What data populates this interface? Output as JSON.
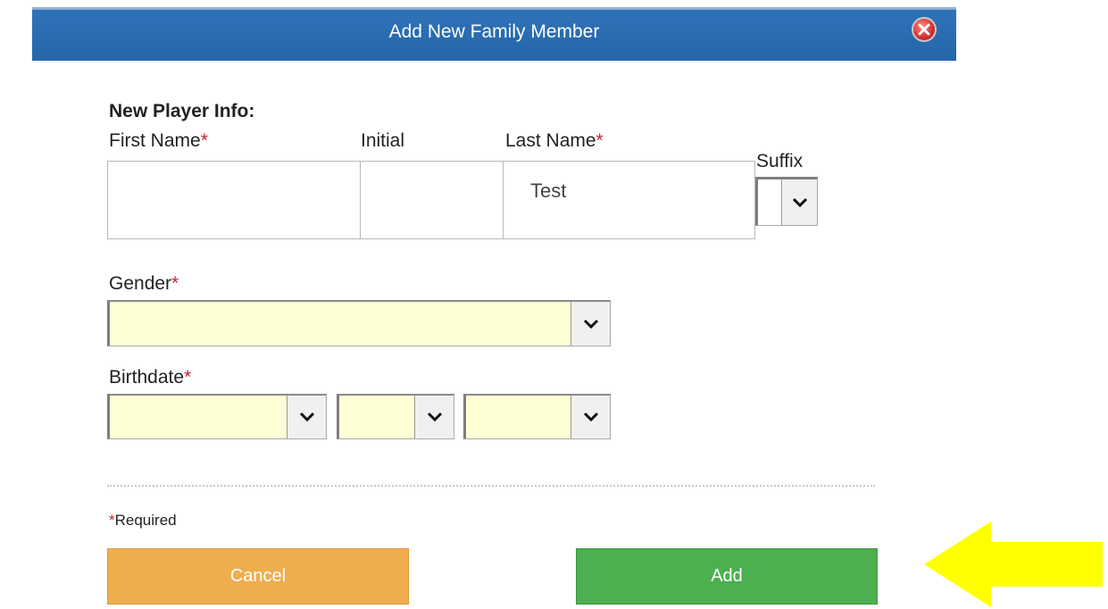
{
  "dialog": {
    "title": "Add New Family Member"
  },
  "form": {
    "section_title": "New Player Info:",
    "first_name": {
      "label": "First Name",
      "value": ""
    },
    "initial": {
      "label": "Initial",
      "value": ""
    },
    "last_name": {
      "label": "Last Name",
      "value": "Test"
    },
    "suffix": {
      "label": "Suffix",
      "value": ""
    },
    "gender": {
      "label": "Gender",
      "value": ""
    },
    "birthdate": {
      "label": "Birthdate",
      "month": "",
      "day": "",
      "year": ""
    },
    "required_marker": "*",
    "required_note": "Required"
  },
  "buttons": {
    "cancel": "Cancel",
    "add": "Add"
  },
  "colors": {
    "titlebar": "#2566aa",
    "cancel": "#f0ad4e",
    "add": "#4caf50",
    "field_bg": "#ffffd6",
    "arrow": "#ffff00",
    "required": "#c8232c"
  },
  "icons": {
    "close": "close-icon",
    "dropdown": "chevron-down-icon",
    "pointer": "arrow-left-icon"
  }
}
